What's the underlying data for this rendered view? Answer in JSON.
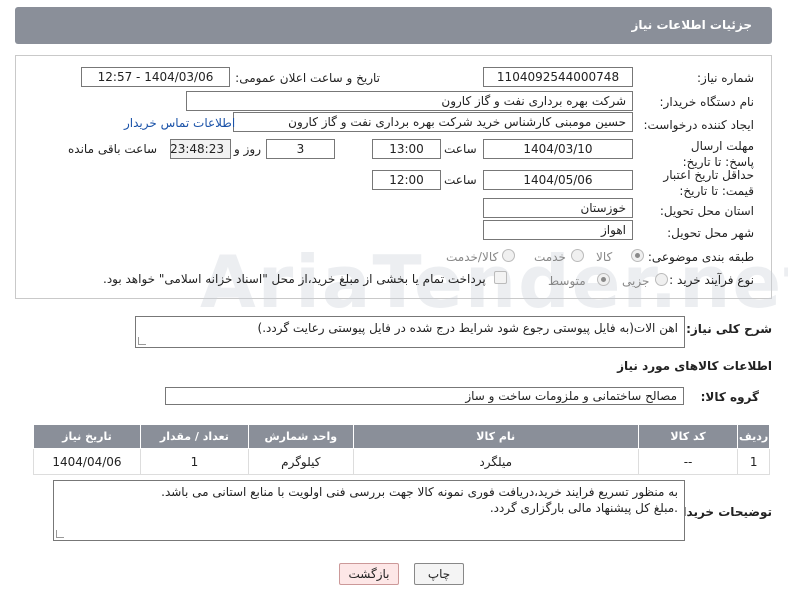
{
  "header": {
    "title": "جزئیات اطلاعات نیاز"
  },
  "fields": {
    "need_number_label": "شماره نیاز:",
    "need_number": "1104092544000748",
    "announce_label": "تاریخ و ساعت اعلان عمومی:",
    "announce_value": "1404/03/06 - 12:57",
    "buyer_org_label": "نام دستگاه خریدار:",
    "buyer_org": "شرکت بهره برداری نفت و گاز کارون",
    "creator_label": "ایجاد کننده درخواست:",
    "creator": "حسین مومبنی کارشناس خرید شرکت بهره برداری نفت و گاز کارون",
    "contact_link": "اطلاعات تماس خریدار",
    "deadline_label": "مهلت ارسال پاسخ: تا تاریخ:",
    "deadline_date": "1404/03/10",
    "time_label": "ساعت",
    "deadline_time": "13:00",
    "days_value": "3",
    "days_label": "روز و",
    "remaining_time": "23:48:23",
    "remaining_label": "ساعت باقی مانده",
    "price_validity_label": "حداقل تاریخ اعتبار قیمت: تا تاریخ:",
    "price_validity_date": "1404/05/06",
    "price_validity_time": "12:00",
    "province_label": "استان محل تحویل:",
    "province": "خوزستان",
    "city_label": "شهر محل تحویل:",
    "city": "اهواز",
    "category_label": "طبقه بندی موضوعی:",
    "category_options": [
      "کالا",
      "خدمت",
      "کالا/خدمت"
    ],
    "process_label": "نوع فرآیند خرید :",
    "process_options": [
      "جزیی",
      "متوسط"
    ],
    "payment_note": "پرداخت تمام یا بخشی از مبلغ خرید،از محل \"اسناد خزانه اسلامی\" خواهد بود."
  },
  "description": {
    "label": "شرح کلی نیاز:",
    "text": "اهن الات(به فایل پیوستی رجوع شود شرایط درج شده در فایل پیوستی رعایت گردد.)"
  },
  "goods": {
    "section_title": "اطلاعات کالاهای مورد نیاز",
    "group_label": "گروه کالا:",
    "group_value": "مصالح ساختمانی و ملزومات ساخت و ساز",
    "columns": [
      "ردیف",
      "کد کالا",
      "نام کالا",
      "واحد شمارش",
      "تعداد / مقدار",
      "تاریخ نیاز"
    ],
    "rows": [
      [
        "1",
        "--",
        "میلگرد",
        "کیلوگرم",
        "1",
        "1404/04/06"
      ]
    ]
  },
  "buyer_notes": {
    "label": "توضیحات خریدار:",
    "line1": "به منظور تسریع فرایند خرید،دریافت فوری نمونه کالا جهت بررسی فنی اولویت با منابع استانی می باشد.",
    "line2": ".مبلغ کل پیشنهاد مالی بارگزاری گردد."
  },
  "buttons": {
    "print": "چاپ",
    "back": "بازگشت"
  },
  "watermark": "AriaTender.net"
}
